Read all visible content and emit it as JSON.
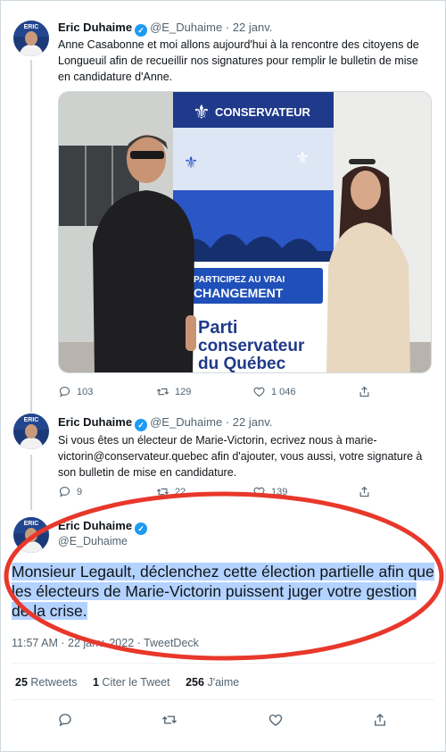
{
  "colors": {
    "accent": "#1d9bf0",
    "text": "#0f1419",
    "muted": "#536471",
    "highlight": "#b3d2ff",
    "annotation_circle": "#e8382b"
  },
  "tweets": [
    {
      "name": "Eric Duhaime",
      "handle": "@E_Duhaime",
      "date": "· 22 janv.",
      "text": "Anne Casabonne et moi allons aujourd'hui à la rencontre des citoyens de Longueuil afin de recueillir nos signatures pour remplir le bulletin de mise en candidature d'Anne.",
      "replies": "103",
      "retweets": "129",
      "likes": "1 046",
      "photo": {
        "banner_brand": "CONSERVATEUR",
        "banner_cta_1": "PARTICIPEZ AU VRAI",
        "banner_cta_2": "CHANGEMENT",
        "banner_party_1": "Parti",
        "banner_party_2": "conservateur",
        "banner_party_3": "du Québec"
      }
    },
    {
      "name": "Eric Duhaime",
      "handle": "@E_Duhaime",
      "date": "· 22 janv.",
      "text": "Si vous êtes un électeur de Marie-Victorin, ecrivez nous à marie-victorin@conservateur.quebec afin d'ajouter, vous aussi, votre signature à son bulletin de mise en candidature.",
      "replies": "9",
      "retweets": "22",
      "likes": "139"
    }
  ],
  "main_tweet": {
    "name": "Eric Duhaime",
    "handle": "@E_Duhaime",
    "text": "Monsieur Legault, déclenchez cette élection partielle afin que les électeurs de Marie-Victorin puissent juger votre gestion de la crise.",
    "time": "11:57 AM",
    "date": "22 janv. 2022",
    "source": "TweetDeck",
    "meta_sep": "·",
    "retweets_count": "25",
    "retweets_label": "Retweets",
    "quotes_count": "1",
    "quotes_label": "Citer le Tweet",
    "likes_count": "256",
    "likes_label": "J'aime"
  },
  "icons": [
    "reply-icon",
    "retweet-icon",
    "like-icon",
    "share-icon",
    "verified-icon"
  ],
  "avatar_text": "ERIC"
}
